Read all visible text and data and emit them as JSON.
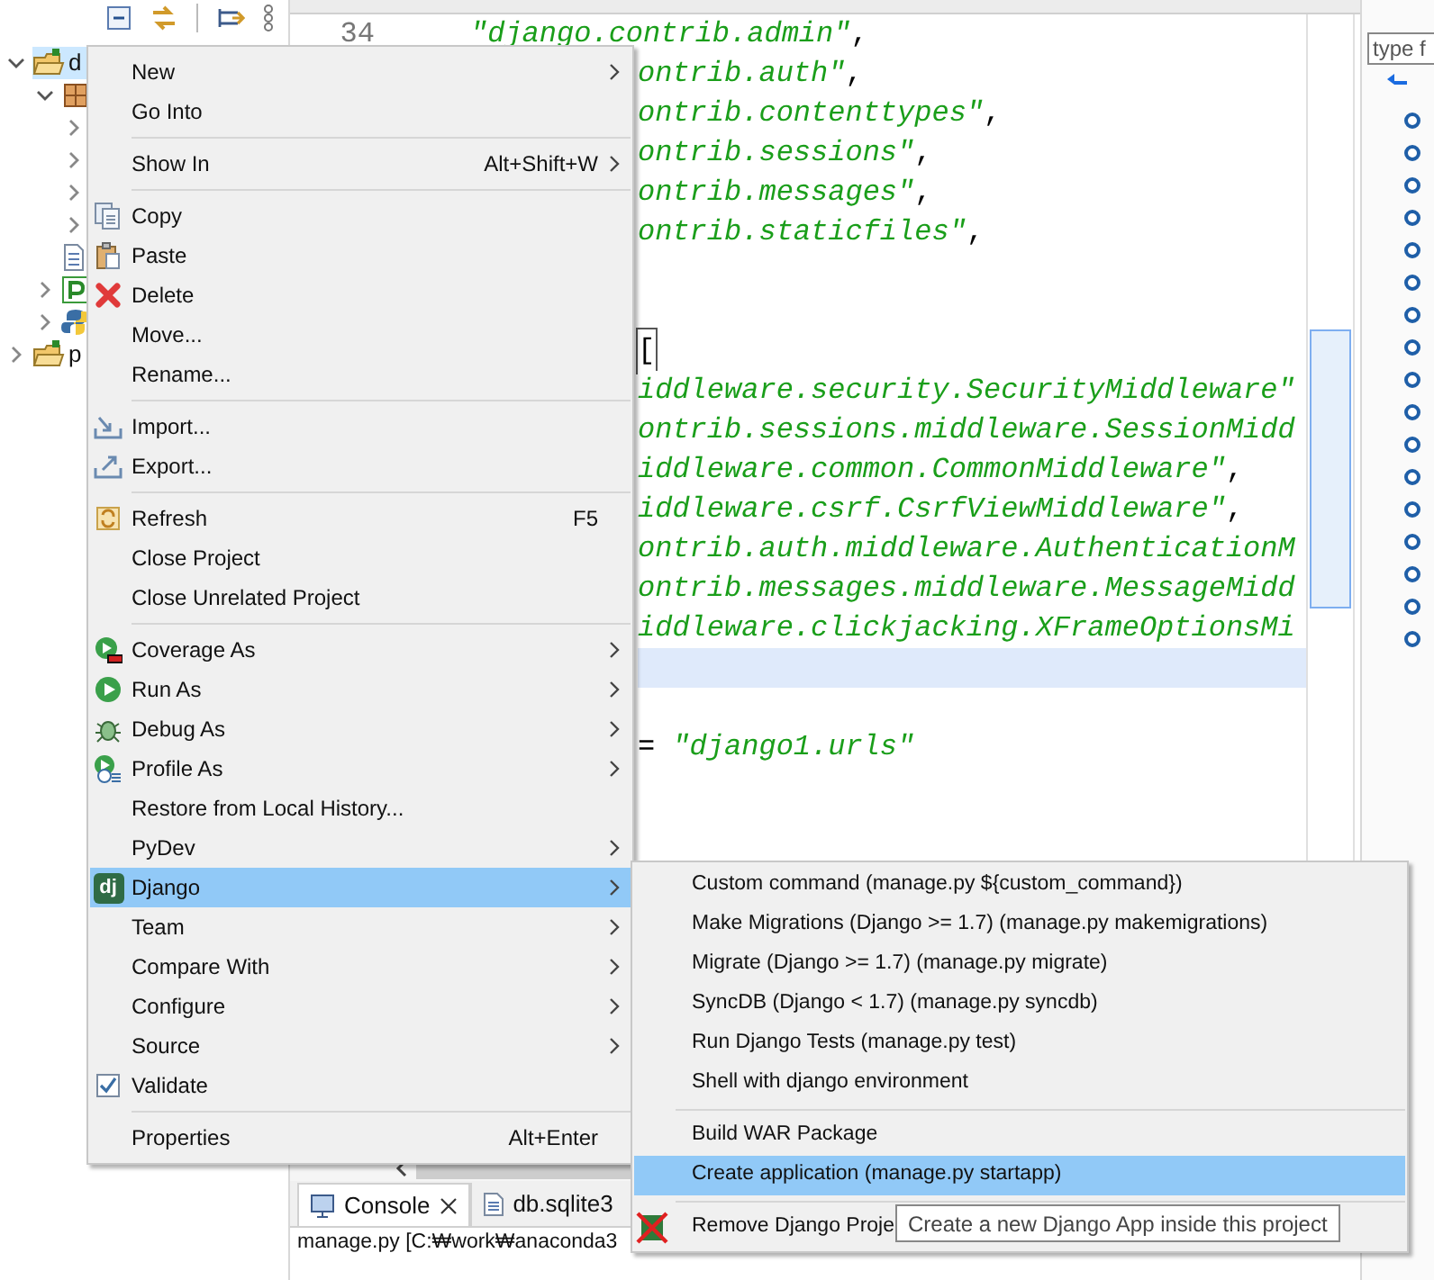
{
  "explorer": {
    "tree": [
      {
        "kind": "project",
        "label": "d",
        "expanded": true,
        "selected": true,
        "children": [
          {
            "kind": "package",
            "expanded": true,
            "children": [
              {
                "expanded": false
              },
              {
                "expanded": false
              },
              {
                "expanded": false
              },
              {
                "expanded": false
              }
            ]
          },
          {
            "kind": "file"
          },
          {
            "kind": "pydev",
            "expanded": false
          },
          {
            "kind": "python",
            "expanded": false
          }
        ]
      },
      {
        "kind": "project",
        "label": "p",
        "expanded": false,
        "selected": false
      }
    ]
  },
  "editor": {
    "lines": [
      {
        "number": "34",
        "current": false,
        "tokens": [
          {
            "kind": "string",
            "text": "\"django.contrib.admin\""
          },
          {
            "kind": "plain",
            "text": ","
          }
        ]
      },
      {
        "current": false,
        "tokens": [
          {
            "kind": "string",
            "text": "ontrib.auth\""
          },
          {
            "kind": "plain",
            "text": ","
          }
        ]
      },
      {
        "current": false,
        "tokens": [
          {
            "kind": "string",
            "text": "ontrib.contenttypes\""
          },
          {
            "kind": "plain",
            "text": ","
          }
        ]
      },
      {
        "current": false,
        "tokens": [
          {
            "kind": "string",
            "text": "ontrib.sessions\""
          },
          {
            "kind": "plain",
            "text": ","
          }
        ]
      },
      {
        "current": false,
        "tokens": [
          {
            "kind": "string",
            "text": "ontrib.messages\""
          },
          {
            "kind": "plain",
            "text": ","
          }
        ]
      },
      {
        "current": false,
        "tokens": [
          {
            "kind": "string",
            "text": "ontrib.staticfiles\""
          },
          {
            "kind": "plain",
            "text": ","
          }
        ]
      },
      {
        "current": false
      },
      {
        "current": false
      },
      {
        "current": false,
        "tokens": [
          {
            "kind": "bracket",
            "text": "["
          }
        ]
      },
      {
        "current": false,
        "tokens": [
          {
            "kind": "string",
            "text": "iddleware.security.SecurityMiddleware\""
          }
        ]
      },
      {
        "current": false,
        "tokens": [
          {
            "kind": "string",
            "text": "ontrib.sessions.middleware.SessionMidd"
          }
        ]
      },
      {
        "current": false,
        "tokens": [
          {
            "kind": "string",
            "text": "iddleware.common.CommonMiddleware\""
          },
          {
            "kind": "plain",
            "text": ","
          }
        ]
      },
      {
        "current": false,
        "tokens": [
          {
            "kind": "string",
            "text": "iddleware.csrf.CsrfViewMiddleware\""
          },
          {
            "kind": "plain",
            "text": ","
          }
        ]
      },
      {
        "current": false,
        "tokens": [
          {
            "kind": "string",
            "text": "ontrib.auth.middleware.AuthenticationM"
          }
        ]
      },
      {
        "current": false,
        "tokens": [
          {
            "kind": "string",
            "text": "ontrib.messages.middleware.MessageMidd"
          }
        ]
      },
      {
        "current": false,
        "tokens": [
          {
            "kind": "string",
            "text": "iddleware.clickjacking.XFrameOptionsMi"
          }
        ]
      },
      {
        "current": true
      },
      {
        "current": false
      },
      {
        "current": false,
        "tokens": [
          {
            "kind": "plain",
            "text": "= "
          },
          {
            "kind": "string",
            "text": "\"django1.urls\""
          }
        ]
      }
    ]
  },
  "outline": {
    "filter": {
      "placeholder": "type f"
    }
  },
  "console": {
    "tabs": [
      {
        "kind": "console",
        "label": "Console",
        "selected": true,
        "closable": true
      },
      {
        "kind": "file",
        "label": "db.sqlite3",
        "selected": false,
        "closable": false
      }
    ],
    "text": "manage.py [C:₩work₩anaconda3"
  },
  "context_menu": {
    "items": [
      {
        "kind": "plain",
        "label": "New",
        "submenu": true,
        "selected": false,
        "checked": false
      },
      {
        "kind": "plain",
        "label": "Go Into",
        "submenu": false,
        "selected": false,
        "checked": false
      },
      {
        "kind": "separator"
      },
      {
        "kind": "plain",
        "label": "Show In",
        "shortcut": "Alt+Shift+W",
        "submenu": true,
        "selected": false,
        "checked": false
      },
      {
        "kind": "separator"
      },
      {
        "kind": "copy",
        "label": "Copy",
        "submenu": false,
        "selected": false,
        "checked": false
      },
      {
        "kind": "paste",
        "label": "Paste",
        "submenu": false,
        "selected": false,
        "checked": false
      },
      {
        "kind": "delete",
        "label": "Delete",
        "submenu": false,
        "selected": false,
        "checked": false
      },
      {
        "kind": "plain",
        "label": "Move...",
        "submenu": false,
        "selected": false,
        "checked": false
      },
      {
        "kind": "plain",
        "label": "Rename...",
        "submenu": false,
        "selected": false,
        "checked": false
      },
      {
        "kind": "separator"
      },
      {
        "kind": "import",
        "label": "Import...",
        "submenu": false,
        "selected": false,
        "checked": false
      },
      {
        "kind": "export",
        "label": "Export...",
        "submenu": false,
        "selected": false,
        "checked": false
      },
      {
        "kind": "separator"
      },
      {
        "kind": "refresh",
        "label": "Refresh",
        "shortcut": "F5",
        "submenu": false,
        "selected": false,
        "checked": false
      },
      {
        "kind": "plain",
        "label": "Close Project",
        "submenu": false,
        "selected": false,
        "checked": false
      },
      {
        "kind": "plain",
        "label": "Close Unrelated Project",
        "submenu": false,
        "selected": false,
        "checked": false
      },
      {
        "kind": "separator"
      },
      {
        "kind": "coverage",
        "label": "Coverage As",
        "submenu": true,
        "selected": false,
        "checked": false
      },
      {
        "kind": "run",
        "label": "Run As",
        "submenu": true,
        "selected": false,
        "checked": false
      },
      {
        "kind": "debug",
        "label": "Debug As",
        "submenu": true,
        "selected": false,
        "checked": false
      },
      {
        "kind": "profile",
        "label": "Profile As",
        "submenu": true,
        "selected": false,
        "checked": false
      },
      {
        "kind": "plain",
        "label": "Restore from Local History...",
        "submenu": false,
        "selected": false,
        "checked": false
      },
      {
        "kind": "plain",
        "label": "PyDev",
        "submenu": true,
        "selected": false,
        "checked": false
      },
      {
        "kind": "django",
        "label": "Django",
        "badge": "dj",
        "submenu": true,
        "selected": true,
        "checked": false
      },
      {
        "kind": "plain",
        "label": "Team",
        "submenu": true,
        "selected": false,
        "checked": false
      },
      {
        "kind": "plain",
        "label": "Compare With",
        "submenu": true,
        "selected": false,
        "checked": false
      },
      {
        "kind": "plain",
        "label": "Configure",
        "submenu": true,
        "selected": false,
        "checked": false
      },
      {
        "kind": "plain",
        "label": "Source",
        "submenu": true,
        "selected": false,
        "checked": false
      },
      {
        "kind": "plain",
        "label": "Validate",
        "submenu": false,
        "selected": false,
        "checked": true
      },
      {
        "kind": "separator"
      },
      {
        "kind": "plain",
        "label": "Properties",
        "shortcut": "Alt+Enter",
        "submenu": false,
        "selected": false,
        "checked": false
      }
    ]
  },
  "django_submenu": {
    "items": [
      {
        "kind": "plain",
        "label": "Custom command (manage.py ${custom_command})",
        "selected": false
      },
      {
        "kind": "plain",
        "label": "Make Migrations (Django >= 1.7) (manage.py makemigrations)",
        "selected": false
      },
      {
        "kind": "plain",
        "label": "Migrate (Django >= 1.7) (manage.py migrate)",
        "selected": false
      },
      {
        "kind": "plain",
        "label": "SyncDB (Django < 1.7) (manage.py syncdb)",
        "selected": false
      },
      {
        "kind": "plain",
        "label": "Run Django Tests (manage.py test)",
        "selected": false
      },
      {
        "kind": "plain",
        "label": "Shell with django environment",
        "selected": false
      },
      {
        "kind": "separator"
      },
      {
        "kind": "plain",
        "label": "Build WAR Package",
        "selected": false
      },
      {
        "kind": "plain",
        "label": "Create application (manage.py startapp)",
        "selected": true
      },
      {
        "kind": "separator"
      },
      {
        "kind": "remove",
        "label": "Remove Django Proje",
        "selected": false
      }
    ]
  },
  "tooltip": {
    "text": "Create a new Django App inside this project"
  }
}
